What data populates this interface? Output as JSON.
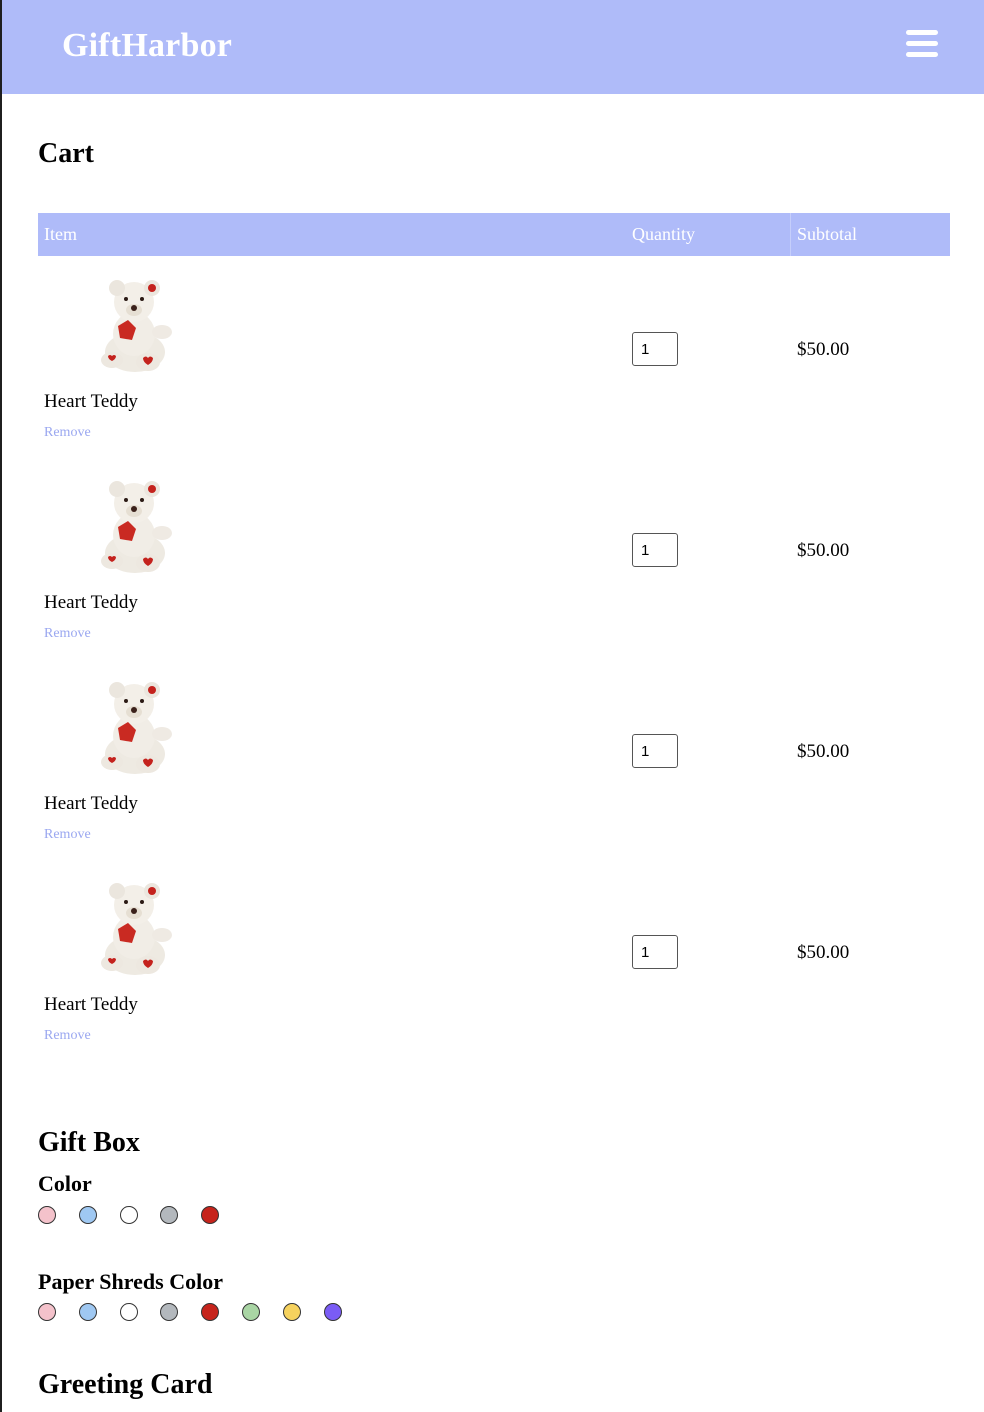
{
  "header": {
    "brand": "GiftHarbor",
    "menu_icon": "hamburger-menu-icon",
    "bg_color": "#afbbf9"
  },
  "cart": {
    "title": "Cart",
    "columns": {
      "item": "Item",
      "quantity": "Quantity",
      "subtotal": "Subtotal"
    },
    "items": [
      {
        "name": "Heart Teddy",
        "remove_label": "Remove",
        "quantity": "1",
        "subtotal": "$50.00"
      },
      {
        "name": "Heart Teddy",
        "remove_label": "Remove",
        "quantity": "1",
        "subtotal": "$50.00"
      },
      {
        "name": "Heart Teddy",
        "remove_label": "Remove",
        "quantity": "1",
        "subtotal": "$50.00"
      },
      {
        "name": "Heart Teddy",
        "remove_label": "Remove",
        "quantity": "1",
        "subtotal": "$50.00"
      }
    ]
  },
  "gift_box": {
    "title": "Gift Box",
    "color_label": "Color",
    "colors": [
      "#f4c2cb",
      "#9fc8f2",
      "#ffffff",
      "#b3b8bd",
      "#c6241c"
    ],
    "shreds_label": "Paper Shreds Color",
    "shred_colors": [
      "#f4c2cb",
      "#9fc8f2",
      "#ffffff",
      "#b3b8bd",
      "#c6241c",
      "#a9d5a4",
      "#f6d25e",
      "#7a5cf5"
    ]
  },
  "greeting_card": {
    "title": "Greeting Card"
  }
}
